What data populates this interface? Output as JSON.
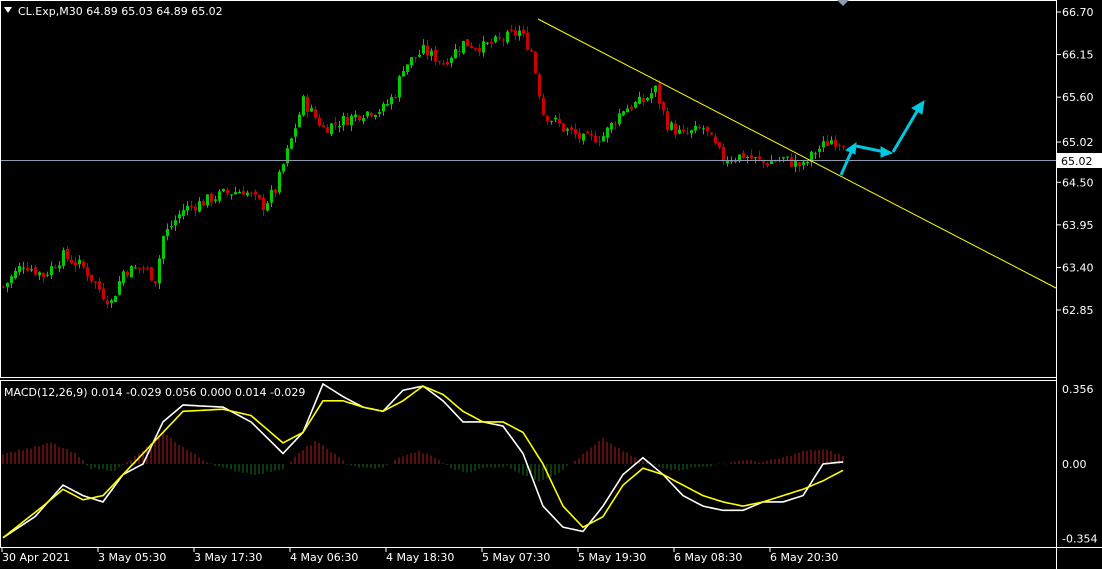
{
  "header": {
    "symbol_info": "CL.Exp,M30  64.89 65.03 64.89 65.02",
    "macd_info": "MACD(12,26,9) 0.014 -0.029 0.056 0.000 0.014 -0.029"
  },
  "colors": {
    "background": "#000000",
    "frame": "#ffffff",
    "bull_candle": "#00cc00",
    "bear_candle": "#cc0000",
    "trendline": "#ffff00",
    "projection_arrow": "#00c8e0",
    "price_line": "#8c9bb0",
    "macd_line": "#ffffff",
    "signal_line": "#ffff00",
    "hist_positive": "#b41e1e",
    "hist_negative": "#1e6e1e"
  },
  "current_price_label": "65.02",
  "chart_data": [
    {
      "type": "candlestick",
      "title": "CL.Exp,M30",
      "yticks": [
        "66.70",
        "66.15",
        "65.60",
        "65.02",
        "64.50",
        "63.95",
        "63.40",
        "62.85"
      ],
      "ylim": [
        62.65,
        66.83
      ],
      "current_price": 65.02,
      "xticks": [
        "30 Apr 2021",
        "3 May 05:30",
        "3 May 17:30",
        "4 May 06:30",
        "4 May 18:30",
        "5 May 07:30",
        "5 May 19:30",
        "6 May 08:30",
        "6 May 20:30"
      ],
      "price_path_anchors": [
        [
          0,
          63.15
        ],
        [
          5,
          63.45
        ],
        [
          10,
          63.3
        ],
        [
          15,
          63.55
        ],
        [
          20,
          63.4
        ],
        [
          25,
          63.05
        ],
        [
          27,
          62.95
        ],
        [
          30,
          63.35
        ],
        [
          35,
          63.4
        ],
        [
          38,
          63.25
        ],
        [
          40,
          63.8
        ],
        [
          45,
          64.15
        ],
        [
          50,
          64.25
        ],
        [
          55,
          64.35
        ],
        [
          60,
          64.4
        ],
        [
          65,
          64.2
        ],
        [
          68,
          64.4
        ],
        [
          72,
          65.05
        ],
        [
          75,
          65.55
        ],
        [
          80,
          65.2
        ],
        [
          85,
          65.3
        ],
        [
          90,
          65.4
        ],
        [
          95,
          65.45
        ],
        [
          98,
          65.65
        ],
        [
          100,
          66.0
        ],
        [
          105,
          66.2
        ],
        [
          110,
          66.05
        ],
        [
          115,
          66.3
        ],
        [
          120,
          66.25
        ],
        [
          125,
          66.35
        ],
        [
          129,
          66.45
        ],
        [
          132,
          66.2
        ],
        [
          135,
          65.4
        ],
        [
          140,
          65.2
        ],
        [
          145,
          65.05
        ],
        [
          150,
          65.1
        ],
        [
          155,
          65.45
        ],
        [
          160,
          65.55
        ],
        [
          163,
          65.7
        ],
        [
          166,
          65.25
        ],
        [
          170,
          65.1
        ],
        [
          175,
          65.2
        ],
        [
          180,
          64.8
        ],
        [
          185,
          64.85
        ],
        [
          190,
          64.75
        ],
        [
          195,
          64.8
        ],
        [
          200,
          64.7
        ],
        [
          203,
          64.9
        ],
        [
          207,
          65.05
        ],
        [
          210,
          65.02
        ]
      ],
      "bar_count": 211,
      "trendline": {
        "start": [
          132,
          66.6
        ],
        "end_label": "63.55 at right edge"
      },
      "annotations": [
        "projection arrow up",
        "projection arrow right",
        "projection arrow up"
      ]
    },
    {
      "type": "line",
      "title": "MACD(12,26,9)",
      "yticks": [
        "0.356",
        "0.00",
        "-0.354"
      ],
      "ylim": [
        -0.4,
        0.4
      ],
      "series": [
        {
          "name": "MACD",
          "anchors": [
            [
              0,
              -0.35
            ],
            [
              8,
              -0.25
            ],
            [
              15,
              -0.1
            ],
            [
              20,
              -0.15
            ],
            [
              25,
              -0.18
            ],
            [
              30,
              -0.05
            ],
            [
              35,
              0.0
            ],
            [
              40,
              0.2
            ],
            [
              45,
              0.28
            ],
            [
              55,
              0.27
            ],
            [
              62,
              0.2
            ],
            [
              70,
              0.05
            ],
            [
              75,
              0.15
            ],
            [
              80,
              0.38
            ],
            [
              85,
              0.32
            ],
            [
              90,
              0.27
            ],
            [
              95,
              0.25
            ],
            [
              100,
              0.35
            ],
            [
              105,
              0.37
            ],
            [
              110,
              0.3
            ],
            [
              115,
              0.2
            ],
            [
              120,
              0.2
            ],
            [
              125,
              0.18
            ],
            [
              130,
              0.05
            ],
            [
              135,
              -0.2
            ],
            [
              140,
              -0.3
            ],
            [
              145,
              -0.32
            ],
            [
              150,
              -0.2
            ],
            [
              155,
              -0.05
            ],
            [
              160,
              0.03
            ],
            [
              165,
              -0.05
            ],
            [
              170,
              -0.15
            ],
            [
              175,
              -0.2
            ],
            [
              180,
              -0.22
            ],
            [
              185,
              -0.22
            ],
            [
              190,
              -0.18
            ],
            [
              195,
              -0.18
            ],
            [
              200,
              -0.15
            ],
            [
              205,
              0.0
            ],
            [
              210,
              0.01
            ]
          ]
        },
        {
          "name": "Signal",
          "anchors": [
            [
              0,
              -0.35
            ],
            [
              10,
              -0.2
            ],
            [
              15,
              -0.12
            ],
            [
              20,
              -0.17
            ],
            [
              25,
              -0.15
            ],
            [
              30,
              -0.05
            ],
            [
              35,
              0.05
            ],
            [
              40,
              0.15
            ],
            [
              45,
              0.25
            ],
            [
              55,
              0.26
            ],
            [
              62,
              0.23
            ],
            [
              70,
              0.1
            ],
            [
              75,
              0.15
            ],
            [
              80,
              0.3
            ],
            [
              85,
              0.3
            ],
            [
              90,
              0.27
            ],
            [
              95,
              0.25
            ],
            [
              100,
              0.3
            ],
            [
              105,
              0.37
            ],
            [
              110,
              0.33
            ],
            [
              115,
              0.25
            ],
            [
              120,
              0.2
            ],
            [
              125,
              0.2
            ],
            [
              130,
              0.15
            ],
            [
              135,
              0.0
            ],
            [
              140,
              -0.2
            ],
            [
              145,
              -0.3
            ],
            [
              150,
              -0.25
            ],
            [
              155,
              -0.1
            ],
            [
              160,
              -0.02
            ],
            [
              165,
              -0.05
            ],
            [
              170,
              -0.1
            ],
            [
              175,
              -0.15
            ],
            [
              180,
              -0.18
            ],
            [
              185,
              -0.2
            ],
            [
              190,
              -0.18
            ],
            [
              195,
              -0.15
            ],
            [
              200,
              -0.12
            ],
            [
              205,
              -0.08
            ],
            [
              210,
              -0.03
            ]
          ]
        }
      ],
      "histogram_anchors": [
        [
          0,
          0.05
        ],
        [
          8,
          0.08
        ],
        [
          12,
          0.1
        ],
        [
          18,
          0.05
        ],
        [
          22,
          -0.02
        ],
        [
          28,
          -0.03
        ],
        [
          32,
          0.02
        ],
        [
          36,
          0.08
        ],
        [
          40,
          0.15
        ],
        [
          45,
          0.08
        ],
        [
          50,
          0.02
        ],
        [
          55,
          -0.02
        ],
        [
          60,
          -0.04
        ],
        [
          64,
          -0.05
        ],
        [
          70,
          -0.02
        ],
        [
          74,
          0.05
        ],
        [
          78,
          0.11
        ],
        [
          82,
          0.06
        ],
        [
          86,
          0.0
        ],
        [
          90,
          -0.02
        ],
        [
          95,
          -0.02
        ],
        [
          100,
          0.04
        ],
        [
          104,
          0.06
        ],
        [
          108,
          0.03
        ],
        [
          112,
          -0.02
        ],
        [
          116,
          -0.04
        ],
        [
          120,
          -0.02
        ],
        [
          126,
          -0.01
        ],
        [
          130,
          -0.05
        ],
        [
          134,
          -0.08
        ],
        [
          138,
          -0.05
        ],
        [
          142,
          0.0
        ],
        [
          146,
          0.06
        ],
        [
          150,
          0.12
        ],
        [
          155,
          0.06
        ],
        [
          160,
          0.01
        ],
        [
          164,
          -0.01
        ],
        [
          168,
          -0.03
        ],
        [
          172,
          -0.02
        ],
        [
          176,
          -0.01
        ],
        [
          180,
          0.0
        ],
        [
          185,
          0.02
        ],
        [
          190,
          0.01
        ],
        [
          195,
          0.03
        ],
        [
          200,
          0.06
        ],
        [
          205,
          0.07
        ],
        [
          210,
          0.04
        ]
      ]
    }
  ]
}
